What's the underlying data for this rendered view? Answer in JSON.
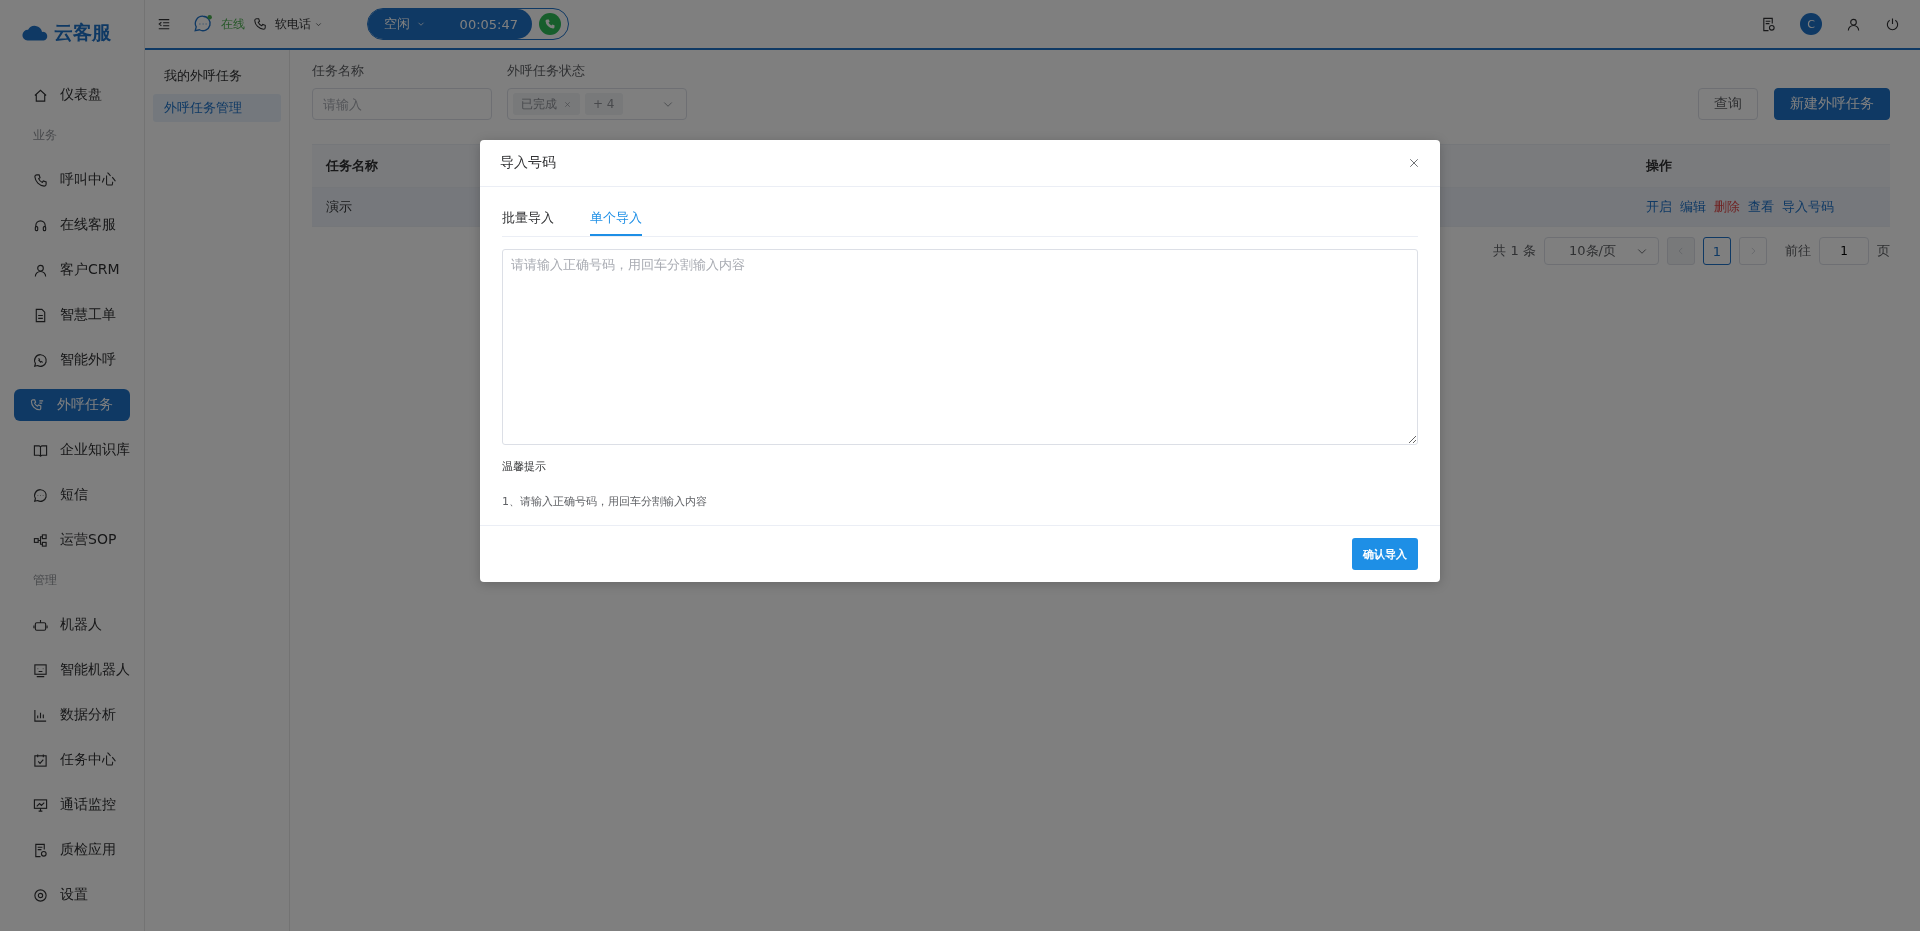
{
  "brand": {
    "name": "云客服"
  },
  "sidebar": {
    "items": [
      {
        "kind": "item",
        "label": "仪表盘",
        "selected": false
      },
      {
        "kind": "section",
        "label": "业务"
      },
      {
        "kind": "item",
        "label": "呼叫中心",
        "selected": false
      },
      {
        "kind": "item",
        "label": "在线客服",
        "selected": false
      },
      {
        "kind": "item",
        "label": "客户CRM",
        "selected": false
      },
      {
        "kind": "item",
        "label": "智慧工单",
        "selected": false
      },
      {
        "kind": "item",
        "label": "智能外呼",
        "selected": false
      },
      {
        "kind": "item",
        "label": "外呼任务",
        "selected": true
      },
      {
        "kind": "item",
        "label": "企业知识库",
        "selected": false
      },
      {
        "kind": "item",
        "label": "短信",
        "selected": false
      },
      {
        "kind": "item",
        "label": "运营SOP",
        "selected": false
      },
      {
        "kind": "section",
        "label": "管理"
      },
      {
        "kind": "item",
        "label": "机器人",
        "selected": false
      },
      {
        "kind": "item",
        "label": "智能机器人",
        "selected": false
      },
      {
        "kind": "item",
        "label": "数据分析",
        "selected": false
      },
      {
        "kind": "item",
        "label": "任务中心",
        "selected": false
      },
      {
        "kind": "item",
        "label": "通话监控",
        "selected": false
      },
      {
        "kind": "item",
        "label": "质检应用",
        "selected": false
      },
      {
        "kind": "item",
        "label": "设置",
        "selected": false
      }
    ]
  },
  "topbar": {
    "presence": "在线",
    "phone_mode": "软电话",
    "call_state": "空闲",
    "timer": "00:05:47",
    "avatar": "C"
  },
  "subnav": {
    "items": [
      {
        "label": "我的外呼任务",
        "selected": false
      },
      {
        "label": "外呼任务管理",
        "selected": true
      }
    ]
  },
  "filters": {
    "name_label": "任务名称",
    "name_placeholder": "请输入",
    "status_label": "外呼任务状态",
    "status_tags": [
      "已完成"
    ],
    "status_more": "+ 4"
  },
  "buttons": {
    "query": "查询",
    "create": "新建外呼任务"
  },
  "table": {
    "columns": [
      "任务名称",
      "操作"
    ],
    "rows": [
      {
        "name": "演示",
        "actions": [
          {
            "label": "开启",
            "kind": "link"
          },
          {
            "label": "编辑",
            "kind": "link"
          },
          {
            "label": "删除",
            "kind": "danger"
          },
          {
            "label": "查看",
            "kind": "link"
          },
          {
            "label": "导入号码",
            "kind": "link"
          }
        ]
      }
    ]
  },
  "pagination": {
    "total": "共 1 条",
    "page_size": "10条/页",
    "pages": [
      {
        "label": "1",
        "selected": true
      }
    ],
    "goto_label": "前往",
    "goto_value": "1",
    "page_suffix": "页"
  },
  "dialog": {
    "title": "导入号码",
    "tabs": [
      {
        "label": "批量导入",
        "selected": false
      },
      {
        "label": "单个导入",
        "selected": true
      }
    ],
    "textarea_placeholder": "请请输入正确号码，用回车分割输入内容",
    "tips_title": "温馨提示",
    "tips": [
      "1、请输入正确号码，用回车分割输入内容"
    ],
    "confirm": "确认导入"
  }
}
